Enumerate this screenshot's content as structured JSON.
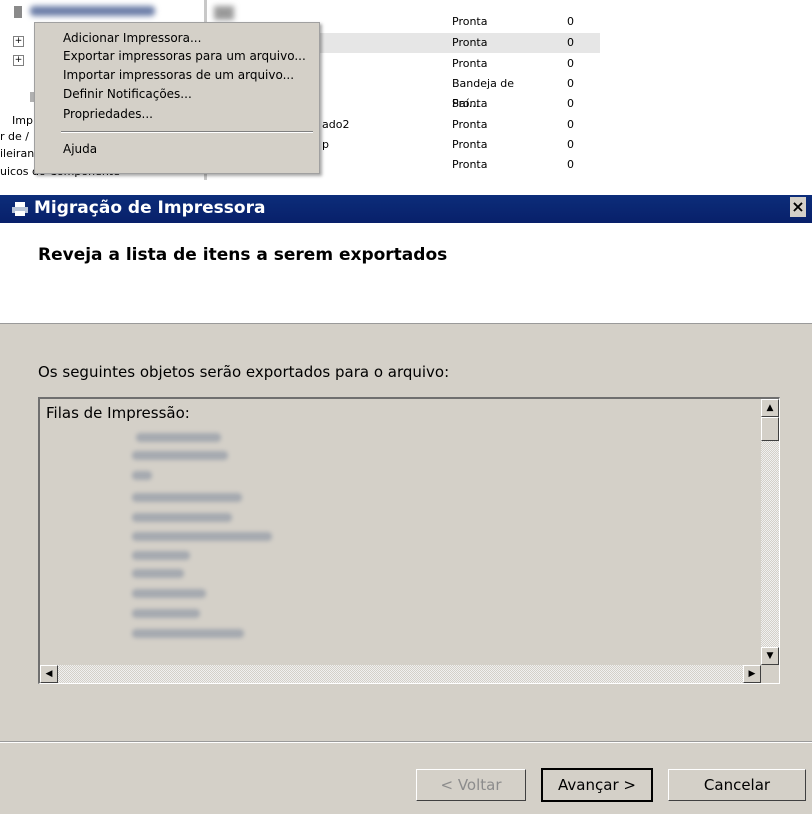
{
  "context_menu": {
    "items": [
      "Adicionar Impressora...",
      "Exportar impressoras para um arquivo...",
      "Importar impressoras de um arquivo...",
      "Definir Notificações...",
      "Propriedades...",
      "Ajuda"
    ]
  },
  "background_tree": {
    "fragments": [
      "Impr",
      "r de /",
      "ileiran",
      "uicos do Componente"
    ],
    "partial_names": [
      "ado2",
      "p"
    ]
  },
  "printer_list": {
    "rows": [
      {
        "status": "Pronta",
        "count": "0"
      },
      {
        "status": "Pronta",
        "count": "0"
      },
      {
        "status": "Pronta",
        "count": "0"
      },
      {
        "status": "Bandeja de Saí...",
        "count": "0"
      },
      {
        "status": "Pronta",
        "count": "0"
      },
      {
        "status": "Pronta",
        "count": "0"
      },
      {
        "status": "Pronta",
        "count": "0"
      },
      {
        "status": "Pronta",
        "count": "0"
      }
    ]
  },
  "dialog": {
    "title": "Migração de Impressora",
    "header": "Reveja a lista de itens a serem exportados",
    "intro": "Os seguintes objetos serão exportados para o arquivo:",
    "list_heading": "Filas de Impressão:",
    "buttons": {
      "back": "< Voltar",
      "next": "Avançar >",
      "cancel": "Cancelar"
    },
    "close_glyph": "×"
  }
}
